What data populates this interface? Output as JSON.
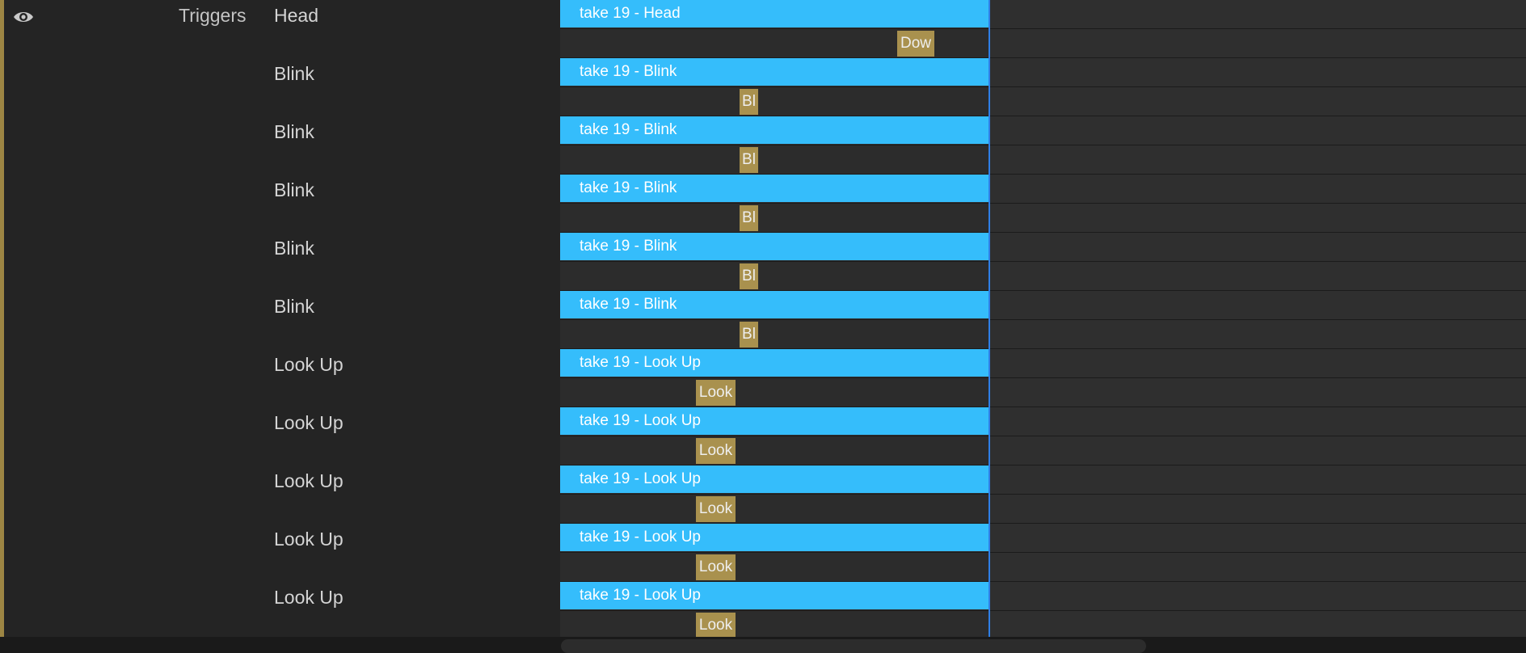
{
  "sidebar": {
    "visibility_icon": "eye-icon",
    "group_label": "Triggers"
  },
  "rows": [
    {
      "label": "Head",
      "take": "take 19 - Head",
      "trigger": "Dow"
    },
    {
      "label": "Blink",
      "take": "take 19 - Blink",
      "trigger": "Bl"
    },
    {
      "label": "Blink",
      "take": "take 19 - Blink",
      "trigger": "Bl"
    },
    {
      "label": "Blink",
      "take": "take 19 - Blink",
      "trigger": "Bl"
    },
    {
      "label": "Blink",
      "take": "take 19 - Blink",
      "trigger": "Bl"
    },
    {
      "label": "Blink",
      "take": "take 19 - Blink",
      "trigger": "Bl"
    },
    {
      "label": "Look Up",
      "take": "take 19 - Look Up",
      "trigger": "Look"
    },
    {
      "label": "Look Up",
      "take": "take 19 - Look Up",
      "trigger": "Look"
    },
    {
      "label": "Look Up",
      "take": "take 19 - Look Up",
      "trigger": "Look"
    },
    {
      "label": "Look Up",
      "take": "take 19 - Look Up",
      "trigger": "Look"
    },
    {
      "label": "Look Up",
      "take": "take 19 - Look Up",
      "trigger": "Look"
    }
  ],
  "colors": {
    "take_bar": "#35bdfb",
    "trigger_chip": "#a9914e",
    "playhead": "#2f7fe6",
    "accent": "#9c8543"
  }
}
